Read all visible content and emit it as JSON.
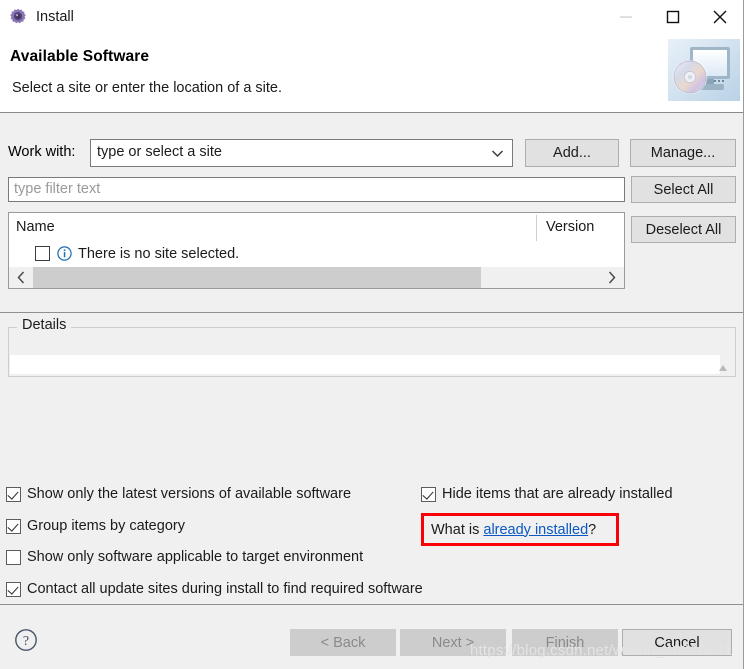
{
  "window": {
    "title": "Install",
    "icon": "install-gear-icon",
    "controls": {
      "minimize": "minimize-icon",
      "maximize": "maximize-icon",
      "close": "close-icon"
    }
  },
  "header": {
    "title": "Available Software",
    "subtitle": "Select a site or enter the location of a site.",
    "artwork": "computer-with-disc-icon"
  },
  "form": {
    "work_with_label": "Work with:",
    "work_with_value": "type or select a site",
    "add_button": "Add...",
    "manage_button": "Manage...",
    "filter_placeholder": "type filter text",
    "select_all_button": "Select All",
    "deselect_all_button": "Deselect All"
  },
  "table": {
    "columns": [
      "Name",
      "Version"
    ],
    "rows": [
      {
        "checked": false,
        "icon": "info-icon",
        "name": "There is no site selected.",
        "version": ""
      }
    ]
  },
  "details": {
    "legend": "Details",
    "content": ""
  },
  "options": [
    {
      "id": "show-latest-versions",
      "label": "Show only the latest versions of available software",
      "checked": true
    },
    {
      "id": "group-items-by-category",
      "label": "Group items by category",
      "checked": true
    },
    {
      "id": "show-applicable-to-target",
      "label": "Show only software applicable to target environment",
      "checked": false
    },
    {
      "id": "contact-all-update-sites",
      "label": "Contact all update sites during install to find required software",
      "checked": true
    },
    {
      "id": "hide-already-installed",
      "label": "Hide items that are already installed",
      "checked": true
    }
  ],
  "already_installed_link": {
    "prefix": "What is ",
    "link": "already installed",
    "suffix": "?",
    "highlight_color": "#fb0007"
  },
  "footer": {
    "help": "help-icon",
    "back_button": "< Back",
    "next_button": "Next >",
    "finish_button": "Finish",
    "cancel_button": "Cancel"
  },
  "watermark": "https://blog.csdn.net/weixin_40916641"
}
